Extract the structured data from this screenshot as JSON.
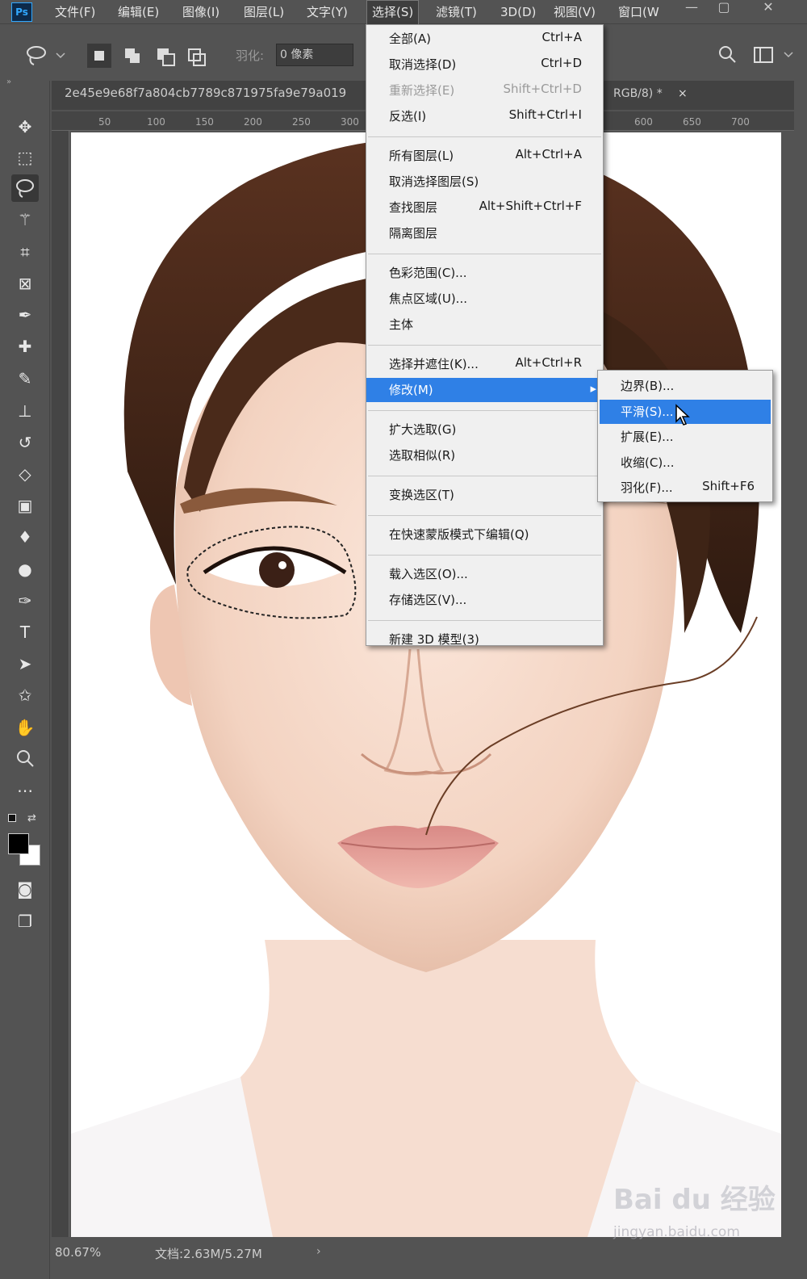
{
  "app": {
    "logo_text": "Ps"
  },
  "menubar": {
    "items": [
      "文件(F)",
      "编辑(E)",
      "图像(I)",
      "图层(L)",
      "文字(Y)",
      "选择(S)",
      "滤镜(T)",
      "3D(D)",
      "视图(V)",
      "窗口(W"
    ],
    "active": "选择(S)"
  },
  "options": {
    "feather_label": "羽化:",
    "feather_value": "0 像素"
  },
  "document": {
    "tab_title": "2e45e9e68f7a804cb7789c871975fa9e79a019",
    "tab_suffix": "RGB/8) *",
    "close_glyph": "×"
  },
  "ruler_h": [
    "50",
    "100",
    "150",
    "200",
    "250",
    "300",
    "600",
    "650",
    "700"
  ],
  "status": {
    "zoom": "80.67%",
    "doc_size": "文档:2.63M/5.27M"
  },
  "select_menu": {
    "groups": [
      [
        {
          "label": "全部(A)",
          "shortcut": "Ctrl+A"
        },
        {
          "label": "取消选择(D)",
          "shortcut": "Ctrl+D"
        },
        {
          "label": "重新选择(E)",
          "shortcut": "Shift+Ctrl+D",
          "disabled": true
        },
        {
          "label": "反选(I)",
          "shortcut": "Shift+Ctrl+I"
        }
      ],
      [
        {
          "label": "所有图层(L)",
          "shortcut": "Alt+Ctrl+A"
        },
        {
          "label": "取消选择图层(S)",
          "shortcut": ""
        },
        {
          "label": "查找图层",
          "shortcut": "Alt+Shift+Ctrl+F"
        },
        {
          "label": "隔离图层",
          "shortcut": ""
        }
      ],
      [
        {
          "label": "色彩范围(C)...",
          "shortcut": ""
        },
        {
          "label": "焦点区域(U)...",
          "shortcut": ""
        },
        {
          "label": "主体",
          "shortcut": ""
        }
      ],
      [
        {
          "label": "选择并遮住(K)...",
          "shortcut": "Alt+Ctrl+R"
        },
        {
          "label": "修改(M)",
          "shortcut": "",
          "submenu": true,
          "highlighted": true
        }
      ],
      [
        {
          "label": "扩大选取(G)",
          "shortcut": ""
        },
        {
          "label": "选取相似(R)",
          "shortcut": ""
        }
      ],
      [
        {
          "label": "变换选区(T)",
          "shortcut": ""
        }
      ],
      [
        {
          "label": "在快速蒙版模式下编辑(Q)",
          "shortcut": ""
        }
      ],
      [
        {
          "label": "载入选区(O)...",
          "shortcut": ""
        },
        {
          "label": "存储选区(V)...",
          "shortcut": ""
        }
      ],
      [
        {
          "label": "新建 3D 模型(3)",
          "shortcut": ""
        }
      ]
    ]
  },
  "modify_submenu": {
    "items": [
      {
        "label": "边界(B)...",
        "shortcut": ""
      },
      {
        "label": "平滑(S)...",
        "shortcut": "",
        "highlighted": true
      },
      {
        "label": "扩展(E)...",
        "shortcut": ""
      },
      {
        "label": "收缩(C)...",
        "shortcut": ""
      },
      {
        "label": "羽化(F)...",
        "shortcut": "Shift+F6"
      }
    ]
  },
  "watermark": {
    "line1": "Bai du 经验",
    "line2": "jingyan.baidu.com"
  },
  "colors": {
    "menu_highlight": "#2f80e6",
    "ui_bg": "#535353",
    "menu_bg": "#f0f0f0"
  }
}
